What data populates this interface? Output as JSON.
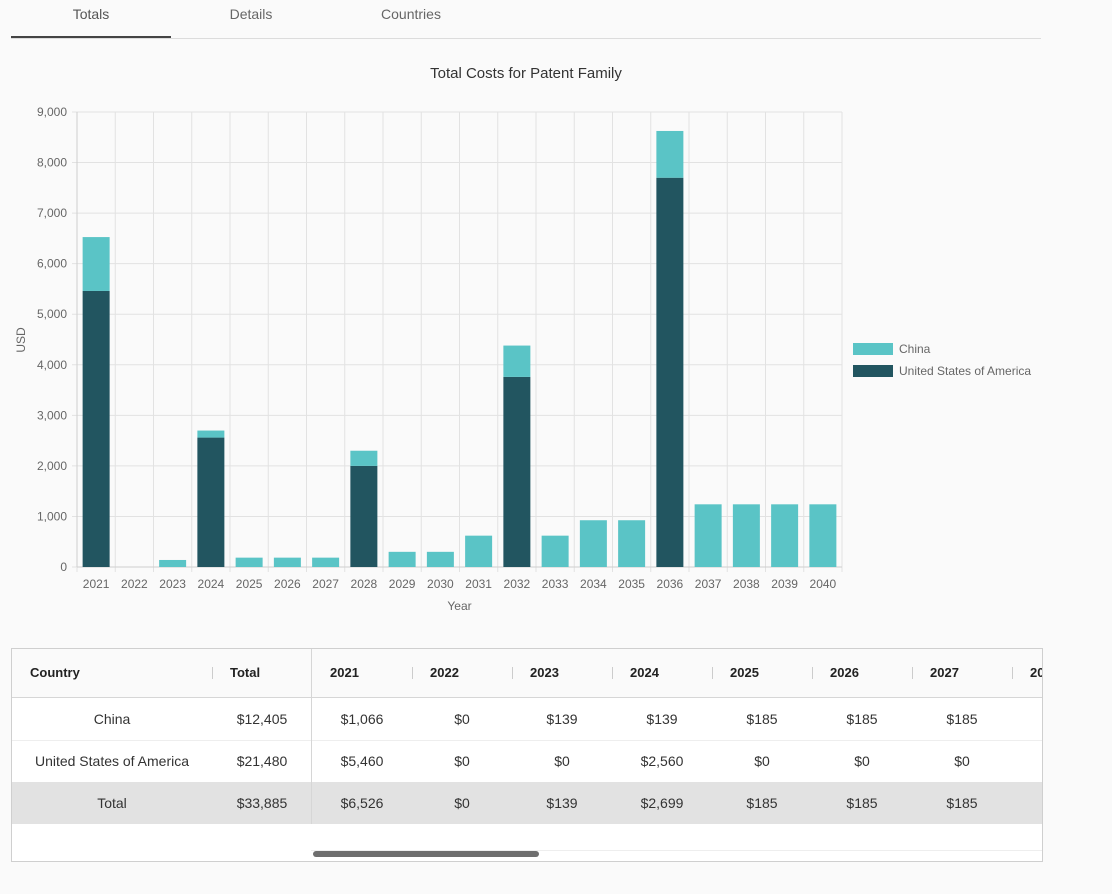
{
  "tabs": [
    {
      "label": "Totals",
      "active": true
    },
    {
      "label": "Details",
      "active": false
    },
    {
      "label": "Countries",
      "active": false
    }
  ],
  "chart_data": {
    "type": "bar",
    "stacked": true,
    "title": "Total Costs for Patent Family",
    "xlabel": "Year",
    "ylabel": "USD",
    "ylim": [
      0,
      9000
    ],
    "yticks": [
      "0",
      "1,000",
      "2,000",
      "3,000",
      "4,000",
      "5,000",
      "6,000",
      "7,000",
      "8,000",
      "9,000"
    ],
    "categories": [
      "2021",
      "2022",
      "2023",
      "2024",
      "2025",
      "2026",
      "2027",
      "2028",
      "2029",
      "2030",
      "2031",
      "2032",
      "2033",
      "2034",
      "2035",
      "2036",
      "2037",
      "2038",
      "2039",
      "2040"
    ],
    "series": [
      {
        "name": "United States of America",
        "color": "#225560",
        "values": [
          5460,
          0,
          0,
          2560,
          0,
          0,
          0,
          2000,
          0,
          0,
          0,
          3760,
          0,
          0,
          0,
          7700,
          0,
          0,
          0,
          0
        ]
      },
      {
        "name": "China",
        "color": "#5ac4c6",
        "values": [
          1066,
          0,
          139,
          139,
          185,
          185,
          185,
          300,
          300,
          300,
          620,
          620,
          620,
          925,
          925,
          925,
          1240,
          1240,
          1240,
          1240
        ]
      }
    ],
    "legend": [
      {
        "name": "China",
        "color": "#5ac4c6"
      },
      {
        "name": "United States of America",
        "color": "#225560"
      }
    ],
    "legend_position": "right",
    "grid": true
  },
  "table": {
    "headers": [
      "Country",
      "Total",
      "2021",
      "2022",
      "2023",
      "2024",
      "2025",
      "2026",
      "2027",
      "20"
    ],
    "rows": [
      {
        "country": "China",
        "total": "$12,405",
        "values": [
          "$1,066",
          "$0",
          "$139",
          "$139",
          "$185",
          "$185",
          "$185"
        ]
      },
      {
        "country": "United States of America",
        "total": "$21,480",
        "values": [
          "$5,460",
          "$0",
          "$0",
          "$2,560",
          "$0",
          "$0",
          "$0"
        ]
      },
      {
        "country": "Total",
        "total": "$33,885",
        "values": [
          "$6,526",
          "$0",
          "$139",
          "$2,699",
          "$185",
          "$185",
          "$185"
        ]
      }
    ]
  }
}
